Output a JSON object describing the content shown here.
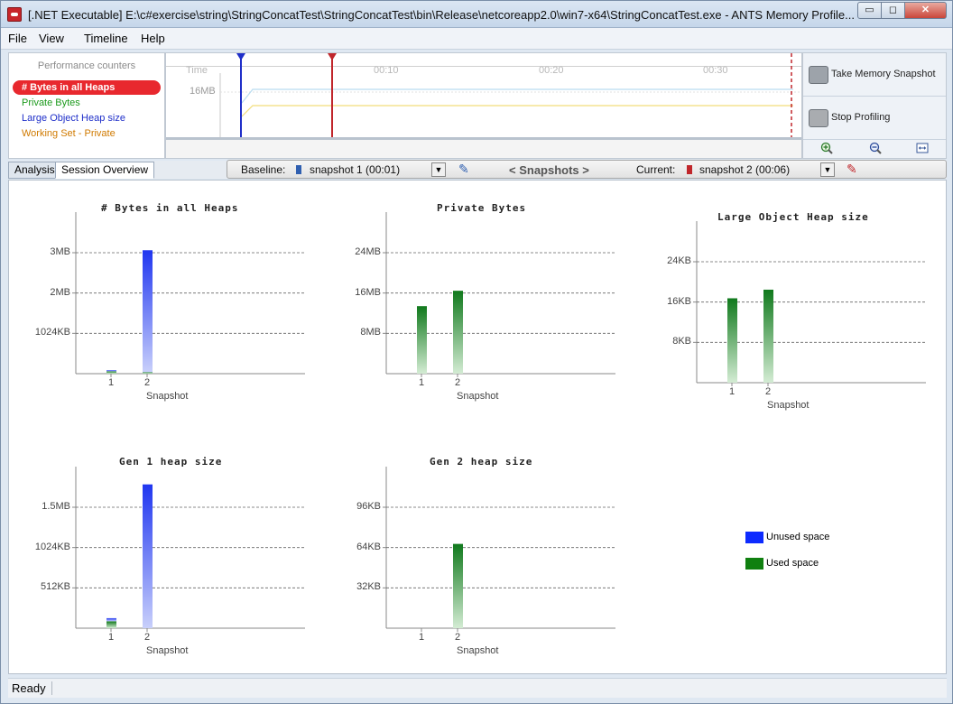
{
  "window": {
    "title": "[.NET Executable] E:\\c#exercise\\string\\StringConcatTest\\StringConcatTest\\bin\\Release\\netcoreapp2.0\\win7-x64\\StringConcatTest.exe - ANTS Memory Profile...",
    "minimize_label": "▭",
    "maximize_label": "◻",
    "close_label": "✕"
  },
  "menu": {
    "items": [
      "File",
      "View",
      "Timeline",
      "Help"
    ]
  },
  "performance_counters": {
    "title": "Performance counters",
    "items": [
      {
        "label": "# Bytes in all Heaps",
        "selected": true,
        "color": "#e8282e"
      },
      {
        "label": "Private Bytes",
        "color": "#1c9a1c"
      },
      {
        "label": "Large Object Heap size",
        "color": "#1f2fc9"
      },
      {
        "label": "Working Set - Private",
        "color": "#d07a00"
      }
    ]
  },
  "timeline": {
    "time_label": "Time",
    "ticks": [
      "00:10",
      "00:20",
      "00:30"
    ],
    "y_label": "16MB"
  },
  "controls": {
    "take_snapshot": "Take Memory Snapshot",
    "stop_profiling": "Stop Profiling",
    "zoom_in_icon": "zoom-in-icon",
    "zoom_out_icon": "zoom-out-icon",
    "fit_icon": "fit-icon"
  },
  "tabs": {
    "analysis": "Analysis",
    "session_overview": "Session Overview"
  },
  "snapshot_bar": {
    "baseline_label": "Baseline:",
    "baseline_value": "snapshot 1 (00:01)",
    "snapshots_label": "< Snapshots >",
    "current_label": "Current:",
    "current_value": "snapshot 2 (00:06)"
  },
  "chart_data": [
    {
      "type": "bar",
      "title": "# Bytes in all Heaps",
      "xlabel": "Snapshot",
      "categories": [
        "1",
        "2"
      ],
      "y_ticks": [
        "1024KB",
        "2MB",
        "3MB"
      ],
      "ylim": [
        0,
        3145728
      ],
      "tick_values": [
        1048576,
        2097152,
        3145728
      ],
      "series": [
        {
          "name": "Used space",
          "values": [
            60000,
            40000
          ]
        },
        {
          "name": "Unused space",
          "values": [
            30000,
            3170000
          ]
        }
      ]
    },
    {
      "type": "bar",
      "title": "Private Bytes",
      "xlabel": "Snapshot",
      "categories": [
        "1",
        "2"
      ],
      "y_ticks": [
        "8MB",
        "16MB",
        "24MB"
      ],
      "ylim": [
        0,
        25165824
      ],
      "tick_values": [
        8388608,
        16777216,
        25165824
      ],
      "series": [
        {
          "name": "Used space",
          "values": [
            14050000,
            17250000
          ]
        }
      ]
    },
    {
      "type": "bar",
      "title": "Large Object Heap size",
      "xlabel": "Snapshot",
      "categories": [
        "1",
        "2"
      ],
      "y_ticks": [
        "8KB",
        "16KB",
        "24KB"
      ],
      "ylim": [
        0,
        24576
      ],
      "tick_values": [
        8192,
        16384,
        24576
      ],
      "series": [
        {
          "name": "Used space",
          "values": [
            17150,
            18900
          ]
        }
      ]
    },
    {
      "type": "bar",
      "title": "Gen 1 heap size",
      "xlabel": "Snapshot",
      "categories": [
        "1",
        "2"
      ],
      "y_ticks": [
        "512KB",
        "1024KB",
        "1.5MB"
      ],
      "ylim": [
        0,
        1572864
      ],
      "tick_values": [
        524288,
        1048576,
        1572864
      ],
      "series": [
        {
          "name": "Used space",
          "values": [
            90000,
            0
          ]
        },
        {
          "name": "Unused space",
          "values": [
            40000,
            1870000
          ]
        }
      ]
    },
    {
      "type": "bar",
      "title": "Gen 2 heap size",
      "xlabel": "Snapshot",
      "categories": [
        "1",
        "2"
      ],
      "y_ticks": [
        "32KB",
        "64KB",
        "96KB"
      ],
      "ylim": [
        0,
        98304
      ],
      "tick_values": [
        32768,
        65536,
        98304
      ],
      "series": [
        {
          "name": "Used space",
          "values": [
            0,
            68500
          ]
        }
      ]
    }
  ],
  "legend": [
    {
      "label": "Unused space",
      "color": "#0d2bff"
    },
    {
      "label": "Used space",
      "color": "#108010"
    }
  ],
  "status": {
    "text": "Ready"
  }
}
